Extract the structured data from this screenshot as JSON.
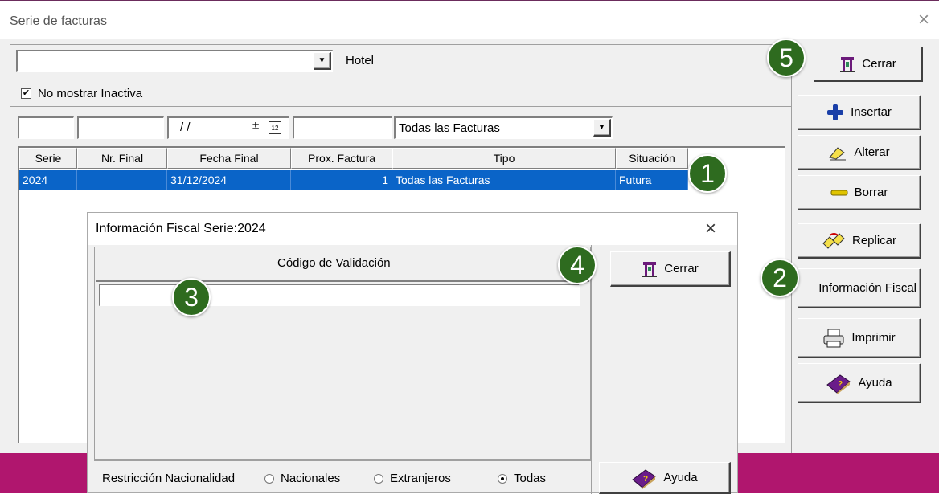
{
  "main_window": {
    "title": "Serie de facturas",
    "close_glyph": "×",
    "hotel_label": "Hotel",
    "hotel_value": "",
    "checkbox_label": "No mostrar Inactiva",
    "checkbox_checked": true,
    "filter": {
      "date_value": "/ /",
      "invoice_type_value": "Todas las Facturas"
    },
    "table": {
      "columns": [
        "Serie",
        "Nr. Final",
        "Fecha Final",
        "Prox. Factura",
        "Tipo",
        "Situación"
      ],
      "rows": [
        {
          "serie": "2024",
          "nr_final": "",
          "fecha_final": "31/12/2024",
          "prox_factura": "1",
          "tipo": "Todas las Facturas",
          "situacion": "Futura"
        }
      ]
    },
    "buttons": {
      "cerrar": "Cerrar",
      "insertar": "Insertar",
      "alterar": "Alterar",
      "borrar": "Borrar",
      "replicar": "Replicar",
      "info_fiscal": "Información Fiscal",
      "imprimir": "Imprimir",
      "ayuda": "Ayuda"
    }
  },
  "dialog": {
    "title": "Información Fiscal Serie:2024",
    "close_glyph": "×",
    "code_label": "Código de Validación",
    "code_value": "",
    "restriction_label": "Restricción Nacionalidad",
    "options": [
      {
        "label": "Nacionales",
        "selected": false
      },
      {
        "label": "Extranjeros",
        "selected": false
      },
      {
        "label": "Todas",
        "selected": true
      }
    ],
    "buttons": {
      "cerrar": "Cerrar",
      "ayuda": "Ayuda"
    }
  },
  "badges": [
    "1",
    "2",
    "3",
    "4",
    "5"
  ],
  "colors": {
    "selection": "#0a64c8",
    "badge": "#2e6b1f",
    "band": "#b0166e"
  }
}
